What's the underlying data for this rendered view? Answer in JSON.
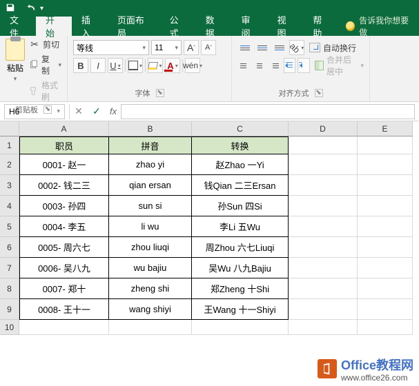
{
  "qat": {
    "save_icon": "save-icon",
    "undo_icon": "undo-icon"
  },
  "tabs": {
    "file": "文件",
    "home": "开始",
    "insert": "插入",
    "page_layout": "页面布局",
    "formulas": "公式",
    "data": "数据",
    "review": "审阅",
    "view": "视图",
    "help": "帮助",
    "tell_me": "告诉我你想要做"
  },
  "clipboard": {
    "paste": "粘贴",
    "cut": "剪切",
    "copy": "复制",
    "painter": "格式刷",
    "group_label": "剪贴板"
  },
  "font": {
    "name": "等线",
    "size": "11",
    "grow": "A",
    "shrink": "A",
    "bold": "B",
    "italic": "I",
    "underline": "U",
    "wen": "wén",
    "font_color": "A",
    "group_label": "字体"
  },
  "align": {
    "wrap": "自动换行",
    "merge": "合并后居中",
    "group_label": "对齐方式"
  },
  "namebox": "H6",
  "fx_label": "fx",
  "columns": [
    "A",
    "B",
    "C",
    "D",
    "E"
  ],
  "rows": [
    "1",
    "2",
    "3",
    "4",
    "5",
    "6",
    "7",
    "8",
    "9",
    "10"
  ],
  "table": {
    "headers": {
      "a": "职员",
      "b": "拼音",
      "c": "转换"
    },
    "data": [
      {
        "a": "0001- 赵一",
        "b": "zhao yi",
        "c": "赵Zhao 一Yi"
      },
      {
        "a": "0002- 钱二三",
        "b": "qian ersan",
        "c": "钱Qian 二三Ersan"
      },
      {
        "a": "0003- 孙四",
        "b": "sun si",
        "c": "孙Sun 四Si"
      },
      {
        "a": "0004- 李五",
        "b": "li wu",
        "c": "李Li 五Wu"
      },
      {
        "a": "0005- 周六七",
        "b": "zhou liuqi",
        "c": "周Zhou 六七Liuqi"
      },
      {
        "a": "0006- 吴八九",
        "b": "wu bajiu",
        "c": "吴Wu 八九Bajiu"
      },
      {
        "a": "0007- 郑十",
        "b": "zheng shi",
        "c": "郑Zheng 十Shi"
      },
      {
        "a": "0008- 王十一",
        "b": "wang shiyi",
        "c": "王Wang 十一Shiyi"
      }
    ]
  },
  "watermark": {
    "brand1": "Office",
    "brand2": "教程网",
    "url": "www.office26.com"
  }
}
